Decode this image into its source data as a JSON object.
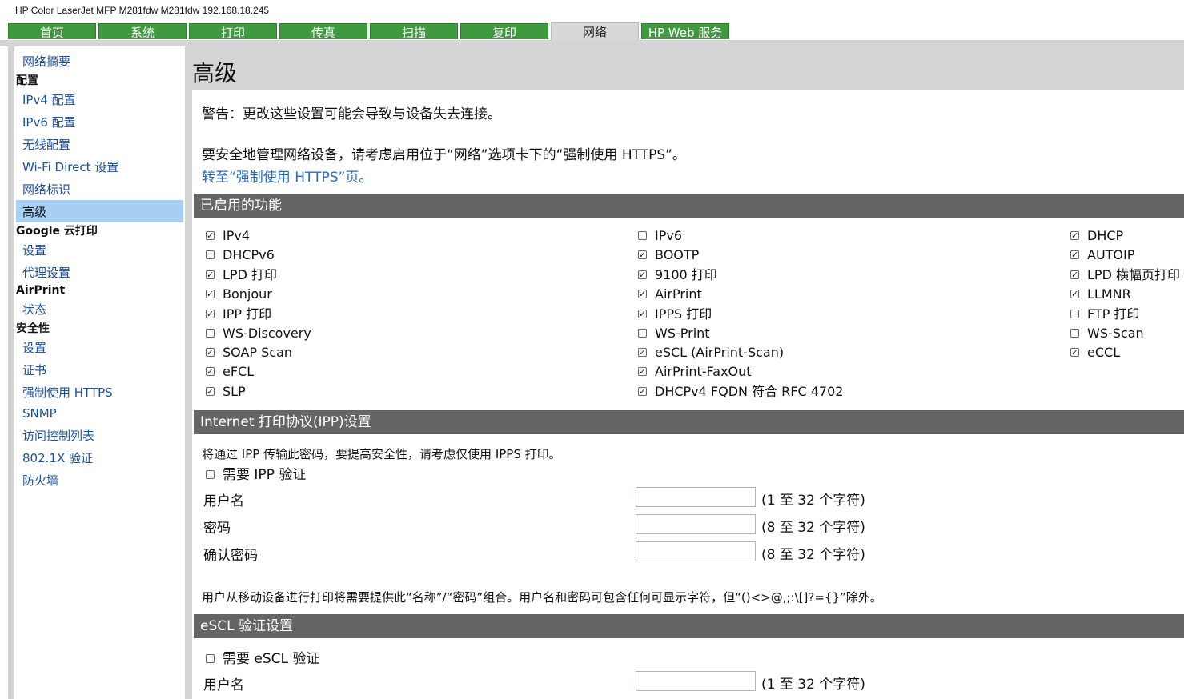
{
  "header": {
    "device_title": "HP Color LaserJet MFP M281fdw    M281fdw    192.168.18.245"
  },
  "tabs": [
    "首页",
    "系统",
    "打印",
    "传真",
    "扫描",
    "复印",
    "网络",
    "HP Web 服务"
  ],
  "active_tab": "网络",
  "sidebar": {
    "summary": "网络摘要",
    "config_head": "配置",
    "ipv4": "IPv4 配置",
    "ipv6": "IPv6 配置",
    "wireless": "无线配置",
    "wifi_direct": "Wi-Fi Direct 设置",
    "identity": "网络标识",
    "advanced": "高级",
    "google_head": "Google 云打印",
    "google_settings": "设置",
    "proxy": "代理设置",
    "airprint_head": "AirPrint",
    "airprint_status": "状态",
    "security_head": "安全性",
    "security_settings": "设置",
    "certs": "证书",
    "force_https": "强制使用 HTTPS",
    "snmp": "SNMP",
    "acl": "访问控制列表",
    "dot1x": "802.1X 验证",
    "firewall": "防火墙"
  },
  "page": {
    "title": "高级",
    "warning": "警告：更改这些设置可能会导致与设备失去连接。",
    "https_note": "要安全地管理网络设备，请考虑启用位于“网络”选项卡下的“强制使用 HTTPS”。",
    "https_link": "转至“强制使用 HTTPS”页。"
  },
  "features": {
    "section_title": "已启用的功能",
    "col1": [
      {
        "label": "IPv4",
        "checked": true
      },
      {
        "label": "DHCPv6",
        "checked": false
      },
      {
        "label": "LPD 打印",
        "checked": true
      },
      {
        "label": "Bonjour",
        "checked": true
      },
      {
        "label": "IPP 打印",
        "checked": true
      },
      {
        "label": "WS-Discovery",
        "checked": false
      },
      {
        "label": "SOAP Scan",
        "checked": true
      },
      {
        "label": "eFCL",
        "checked": true
      },
      {
        "label": "SLP",
        "checked": true
      }
    ],
    "col2": [
      {
        "label": "IPv6",
        "checked": false
      },
      {
        "label": "BOOTP",
        "checked": true
      },
      {
        "label": "9100 打印",
        "checked": true
      },
      {
        "label": "AirPrint",
        "checked": true
      },
      {
        "label": "IPPS 打印",
        "checked": true
      },
      {
        "label": "WS-Print",
        "checked": false
      },
      {
        "label": "eSCL (AirPrint-Scan)",
        "checked": true
      },
      {
        "label": "AirPrint-FaxOut",
        "checked": true
      },
      {
        "label": "DHCPv4 FQDN 符合 RFC 4702",
        "checked": true
      }
    ],
    "col3": [
      {
        "label": "DHCP",
        "checked": true
      },
      {
        "label": "AUTOIP",
        "checked": true
      },
      {
        "label": "LPD 横幅页打印",
        "checked": true
      },
      {
        "label": "LLMNR",
        "checked": true
      },
      {
        "label": "FTP 打印",
        "checked": false
      },
      {
        "label": "WS-Scan",
        "checked": false
      },
      {
        "label": "eCCL",
        "checked": true
      }
    ]
  },
  "ipp": {
    "section_title": "Internet 打印协议(IPP)设置",
    "note": "将通过 IPP 传输此密码，要提高安全性，请考虑仅使用 IPPS 打印。",
    "require_label": "需要 IPP 验证",
    "require_checked": false,
    "username_label": "用户名",
    "username_value": "",
    "username_hint": "(1 至 32 个字符)",
    "password_label": "密码",
    "password_hint": "(8 至 32 个字符)",
    "confirm_label": "确认密码",
    "confirm_hint": "(8 至 32 个字符)",
    "mobile_note": "用户从移动设备进行打印将需要提供此“名称”/“密码”组合。用户名和密码可包含任何可显示字符，但“()<>@,;:\\[]?={}”除外。"
  },
  "escl": {
    "section_title": "eSCL 验证设置",
    "require_label": "需要 eSCL 验证",
    "require_checked": false,
    "username_label": "用户名",
    "username_hint": "(1 至 32 个字符)"
  }
}
